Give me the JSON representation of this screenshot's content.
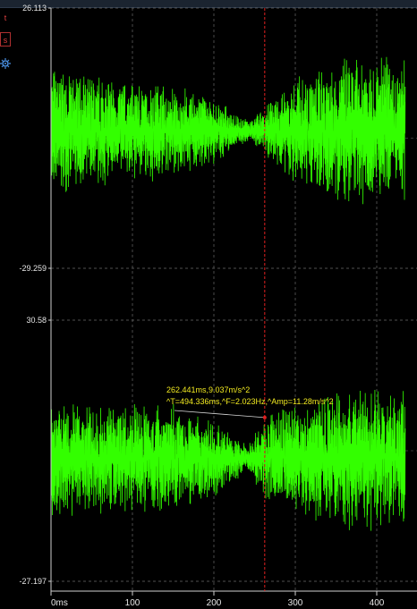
{
  "toolbar": {
    "btn1_label": "t",
    "btn2_label": "s",
    "gear_icon": "gear-icon"
  },
  "chart_data": {
    "type": "line",
    "x_unit_label": "ms",
    "x_ticks": [
      "0ms",
      "100",
      "200",
      "300",
      "400"
    ],
    "xlim": [
      0,
      435
    ],
    "grid": true,
    "cursor_x": 262.441,
    "colors": {
      "signal": "#33ff00",
      "cursor": "#e02020",
      "annotation": "#f2ea20",
      "grid": "#6a6a6a",
      "axis": "#cfcfcf"
    },
    "panels": [
      {
        "ylim": [
          -29.259,
          26.113
        ],
        "y_labels": [
          "26.113",
          "-29.259"
        ],
        "envelope": {
          "x": [
            0,
            50,
            100,
            150,
            200,
            240,
            262,
            300,
            350,
            400,
            435
          ],
          "amplitude": [
            14,
            12.5,
            12,
            10.5,
            7.5,
            2.5,
            5,
            13,
            16,
            17,
            16
          ]
        }
      },
      {
        "ylim": [
          -27.197,
          30.58
        ],
        "y_labels": [
          "30.58",
          "-27.197"
        ],
        "envelope": {
          "x": [
            0,
            50,
            100,
            150,
            200,
            240,
            262,
            300,
            350,
            400,
            435
          ],
          "amplitude": [
            14,
            13,
            13,
            12.5,
            9,
            3,
            9,
            14,
            16,
            17,
            17
          ]
        },
        "annotation": {
          "point_x": 262.441,
          "point_y": 9.037,
          "line1": "262.441ms,9.037m/s^2",
          "line2": "^T=494.336ms,^F=2.023Hz,^Amp=11.28m/s^2"
        }
      }
    ]
  }
}
